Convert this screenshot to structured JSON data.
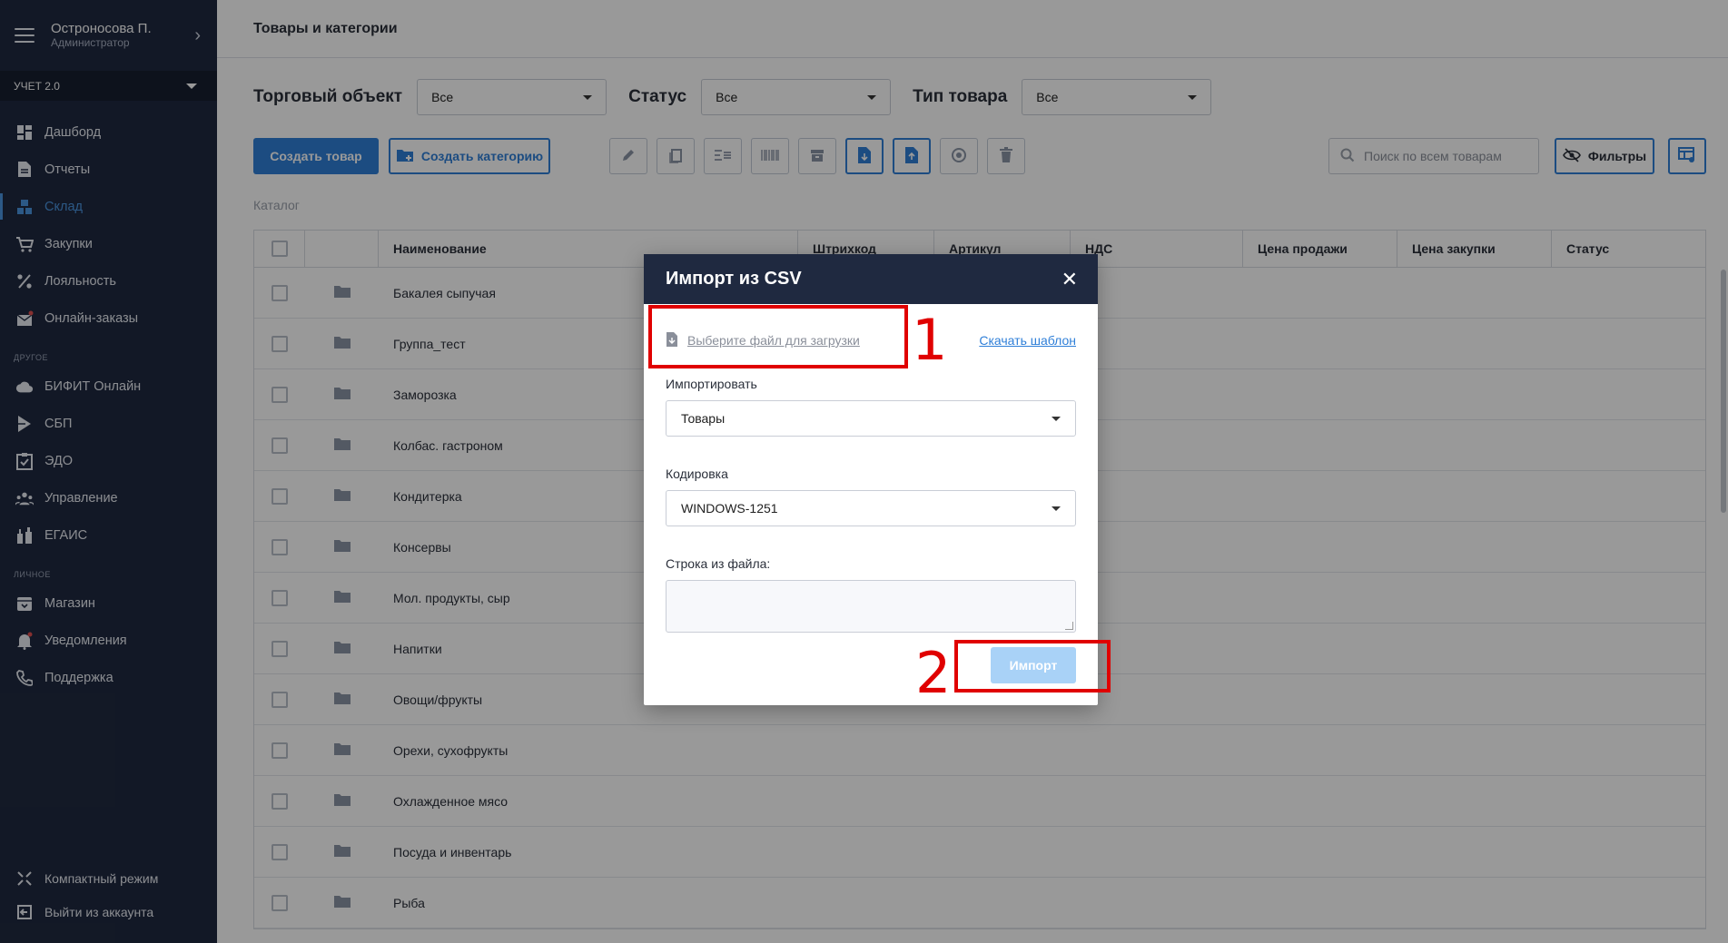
{
  "sidebar": {
    "user_name": "Остроносова П.",
    "user_role": "Администратор",
    "account": "УЧЕТ 2.0",
    "items": [
      {
        "label": "Дашборд",
        "icon": "dashboard-icon"
      },
      {
        "label": "Отчеты",
        "icon": "document-icon"
      },
      {
        "label": "Склад",
        "icon": "warehouse-icon",
        "active": true
      },
      {
        "label": "Закупки",
        "icon": "cart-icon"
      },
      {
        "label": "Лояльность",
        "icon": "percent-icon"
      },
      {
        "label": "Онлайн-заказы",
        "icon": "mail-icon"
      }
    ],
    "section_other": "ДРУГОЕ",
    "other_items": [
      {
        "label": "БИФИТ Онлайн",
        "icon": "cloud-icon"
      },
      {
        "label": "СБП",
        "icon": "sbp-icon"
      },
      {
        "label": "ЭДО",
        "icon": "clipboard-icon"
      },
      {
        "label": "Управление",
        "icon": "team-icon"
      },
      {
        "label": "ЕГАИС",
        "icon": "bottles-icon"
      }
    ],
    "section_personal": "ЛИЧНОЕ",
    "personal_items": [
      {
        "label": "Магазин",
        "icon": "store-icon"
      },
      {
        "label": "Уведомления",
        "icon": "bell-icon"
      },
      {
        "label": "Поддержка",
        "icon": "phone-icon"
      }
    ],
    "compact_mode": "Компактный режим",
    "logout": "Выйти из аккаунта"
  },
  "header": {
    "title": "Товары и категории"
  },
  "filters": {
    "object_label": "Торговый объект",
    "object_value": "Все",
    "status_label": "Статус",
    "status_value": "Все",
    "type_label": "Тип товара",
    "type_value": "Все"
  },
  "toolbar": {
    "create_product": "Создать товар",
    "create_category": "Создать категорию",
    "search_placeholder": "Поиск по всем товарам",
    "filters_button": "Фильтры"
  },
  "breadcrumb": "Каталог",
  "table": {
    "columns": [
      "Наименование",
      "Штрихкод",
      "Артикул",
      "НДС",
      "Цена продажи",
      "Цена закупки",
      "Статус"
    ],
    "rows": [
      "Бакалея сыпучая",
      "Группа_тест",
      "Заморозка",
      "Колбас. гастроном",
      "Кондитерка",
      "Консервы",
      "Мол. продукты, сыр",
      "Напитки",
      "Овощи/фрукты",
      "Орехи, сухофрукты",
      "Охлажденное мясо",
      "Посуда и инвентарь",
      "Рыба"
    ]
  },
  "modal": {
    "title": "Импорт из CSV",
    "file_pick": "Выберите файл для загрузки",
    "download_template": "Скачать шаблон",
    "import_label": "Импортировать",
    "import_value": "Товары",
    "encoding_label": "Кодировка",
    "encoding_value": "WINDOWS-1251",
    "row_label": "Строка из файла:",
    "import_button": "Импорт"
  },
  "annotations": {
    "marker1": "1",
    "marker2": "2",
    "color": "#e00000"
  },
  "colors": {
    "sidebar": "#1f2940",
    "accent": "#2f7fd8",
    "disabled_button": "#a9d2f7"
  }
}
